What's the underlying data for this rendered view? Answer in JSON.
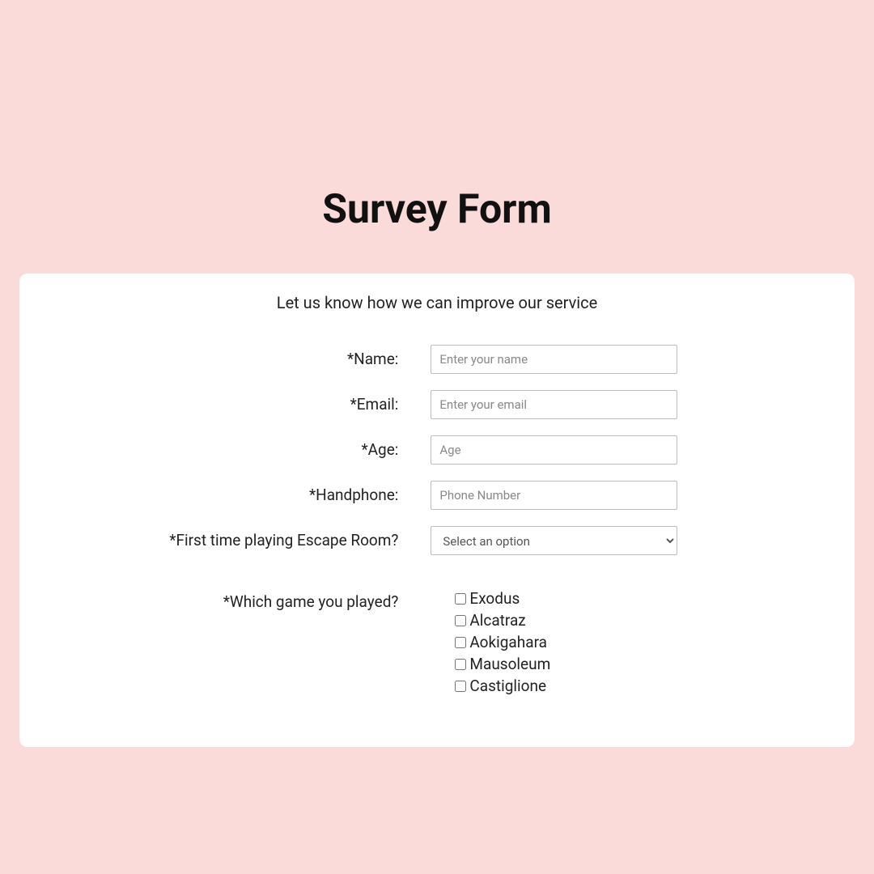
{
  "title": "Survey Form",
  "subtitle": "Let us know how we can improve our service",
  "fields": {
    "name": {
      "label": "*Name:",
      "placeholder": "Enter your name"
    },
    "email": {
      "label": "*Email:",
      "placeholder": "Enter your email"
    },
    "age": {
      "label": "*Age:",
      "placeholder": "Age"
    },
    "handphone": {
      "label": "*Handphone:",
      "placeholder": "Phone Number"
    },
    "firsttime": {
      "label": "*First time playing Escape Room?",
      "selected": "Select an option"
    },
    "games": {
      "label": "*Which game you played?",
      "options": [
        "Exodus",
        "Alcatraz",
        "Aokigahara",
        "Mausoleum",
        "Castiglione"
      ]
    }
  }
}
